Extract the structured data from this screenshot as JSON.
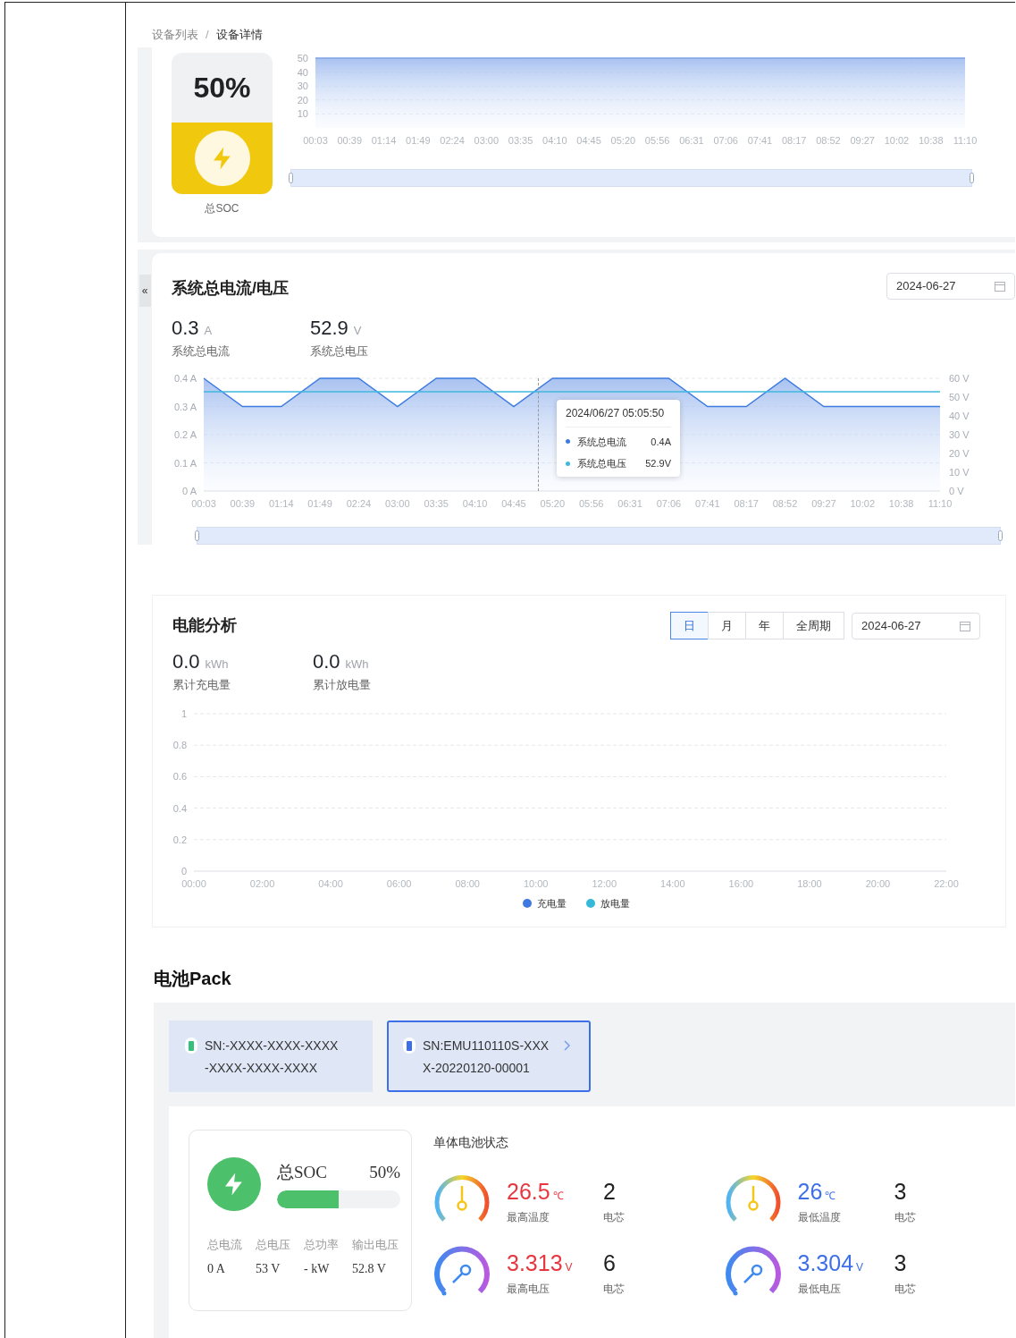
{
  "breadcrumb": {
    "items": [
      {
        "label": "设备列表"
      },
      {
        "label": "设备详情"
      }
    ],
    "separator": "/"
  },
  "soc_panel": {
    "percent": "50%",
    "label": "总SOC",
    "chart_data": {
      "type": "line",
      "categories": [
        "00:03",
        "00:39",
        "01:14",
        "01:49",
        "02:24",
        "03:00",
        "03:35",
        "04:10",
        "04:45",
        "05:20",
        "05:56",
        "06:31",
        "07:06",
        "07:41",
        "08:17",
        "08:52",
        "09:27",
        "10:02",
        "10:38",
        "11:10"
      ],
      "ylim": [
        0,
        50
      ],
      "yticks": [
        10,
        20,
        30,
        40,
        50
      ],
      "grid": true,
      "series": [
        {
          "color": "#7ea3e6",
          "values": [
            50,
            50,
            50,
            50,
            50,
            50,
            50,
            50,
            50,
            50,
            50,
            50,
            50,
            50,
            50,
            50,
            50,
            50,
            50,
            50
          ]
        }
      ]
    },
    "zoom_slider": {
      "level": 1
    }
  },
  "current_voltage": {
    "collapse": "«",
    "title": "系统总电流/电压",
    "date": "2024-06-27",
    "stats": [
      {
        "value": "0.3",
        "unit": "A",
        "label": "系统总电流"
      },
      {
        "value": "52.9",
        "unit": "V",
        "label": "系统总电压"
      }
    ],
    "chart_data": {
      "type": "line",
      "grid": true,
      "categories": [
        "00:03",
        "00:39",
        "01:14",
        "01:49",
        "02:24",
        "03:00",
        "03:35",
        "04:10",
        "04:45",
        "05:20",
        "05:56",
        "06:31",
        "07:06",
        "07:41",
        "08:17",
        "08:52",
        "09:27",
        "10:02",
        "10:38",
        "11:10"
      ],
      "ylim": [
        0,
        0.4
      ],
      "yticks": [
        {
          "value": 0,
          "label": "0 A"
        },
        {
          "value": 0.1,
          "label": "0.1 A"
        },
        {
          "value": 0.2,
          "label": "0.2 A"
        },
        {
          "value": 0.3,
          "label": "0.3 A"
        },
        {
          "value": 0.4,
          "label": "0.4 A"
        }
      ],
      "y2lim": [
        0,
        60
      ],
      "y2ticks": [
        {
          "value": 0,
          "label": "0 V"
        },
        {
          "value": 10,
          "label": "10 V"
        },
        {
          "value": 20,
          "label": "20 V"
        },
        {
          "value": 30,
          "label": "30 V"
        },
        {
          "value": 40,
          "label": "40 V"
        },
        {
          "value": 50,
          "label": "50 V"
        },
        {
          "value": 60,
          "label": "60 V"
        }
      ],
      "series": [
        {
          "name": "系统总电流",
          "color": "#3d7be0",
          "values": [
            0.4,
            0.3,
            0.3,
            0.4,
            0.4,
            0.3,
            0.4,
            0.4,
            0.3,
            0.4,
            0.4,
            0.4,
            0.4,
            0.3,
            0.3,
            0.4,
            0.3,
            0.3,
            0.3,
            0.3
          ]
        },
        {
          "name": "系统总电压",
          "color": "#3fb8df",
          "axis": "y2",
          "values": [
            52.9,
            52.9,
            52.9,
            52.9,
            52.9,
            52.9,
            52.9,
            52.9,
            52.9,
            52.9,
            52.9,
            52.9,
            52.9,
            52.9,
            52.9,
            52.9,
            52.9,
            52.9,
            52.9,
            52.9
          ]
        }
      ]
    },
    "tooltip": {
      "time": "2024/06/27 05:05:50",
      "rows": [
        {
          "value": "0.4A"
        },
        {
          "value": "52.9V"
        }
      ]
    },
    "zoom_slider": {
      "level": 1
    }
  },
  "energy": {
    "title": "电能分析",
    "periods": [
      {
        "label": "日",
        "selected": true
      },
      {
        "label": "月",
        "selected": false
      },
      {
        "label": "年",
        "selected": false
      },
      {
        "label": "全周期",
        "selected": false
      }
    ],
    "date": "2024-06-27",
    "stats": [
      {
        "value": "0.0",
        "unit": "kWh",
        "label": "累计充电量"
      },
      {
        "value": "0.0",
        "unit": "kWh",
        "label": "累计放电量"
      }
    ],
    "chart_data": {
      "type": "line",
      "grid": true,
      "categories": [
        "00:00",
        "02:00",
        "04:00",
        "06:00",
        "08:00",
        "10:00",
        "12:00",
        "14:00",
        "16:00",
        "18:00",
        "20:00",
        "22:00"
      ],
      "ylim": [
        0,
        1
      ],
      "yticks": [
        0,
        0.2,
        0.4,
        0.6,
        0.8,
        1
      ],
      "series": [
        {
          "name": "充电量",
          "color": "#3f78e0",
          "values": [
            null,
            null,
            null,
            null,
            null,
            null,
            null,
            null,
            null,
            null,
            null,
            null
          ]
        },
        {
          "name": "放电量",
          "color": "#36b9d9",
          "values": [
            null,
            null,
            null,
            null,
            null,
            null,
            null,
            null,
            null,
            null,
            null,
            null
          ]
        }
      ]
    }
  },
  "battery_pack": {
    "title": "电池Pack",
    "packs": [
      {
        "sn": "SN:-XXXX-XXXX-XXXX-XXXX-XXXX-XXXX",
        "selected": false,
        "color": "#34c07a"
      },
      {
        "sn": "SN:EMU110110S-XXXX-20220120-00001",
        "selected": true,
        "color": "#3d6fe8"
      }
    ],
    "summary": {
      "soc_label": "总SOC",
      "soc_value": "50%",
      "level": 0.5,
      "metrics": [
        {
          "label": "总电流",
          "value": "0 A"
        },
        {
          "label": "总电压",
          "value": "53 V"
        },
        {
          "label": "总功率",
          "value": "- kW"
        },
        {
          "label": "输出电压",
          "value": "52.8 V"
        }
      ]
    },
    "cell_status": {
      "title": "单体电池状态",
      "items": [
        {
          "kind": "temperature",
          "value": "26.5",
          "unit": "℃",
          "label": "最高温度",
          "count": "2",
          "count_label": "电芯",
          "color": "#e8363f"
        },
        {
          "kind": "temperature",
          "value": "26",
          "unit": "℃",
          "label": "最低温度",
          "count": "3",
          "count_label": "电芯",
          "color": "#3d6fe8"
        },
        {
          "kind": "voltage",
          "value": "3.313",
          "unit": "V",
          "label": "最高电压",
          "count": "6",
          "count_label": "电芯",
          "color": "#e8363f"
        },
        {
          "kind": "voltage",
          "value": "3.304",
          "unit": "V",
          "label": "最低电压",
          "count": "3",
          "count_label": "电芯",
          "color": "#3d6fe8"
        }
      ]
    }
  }
}
